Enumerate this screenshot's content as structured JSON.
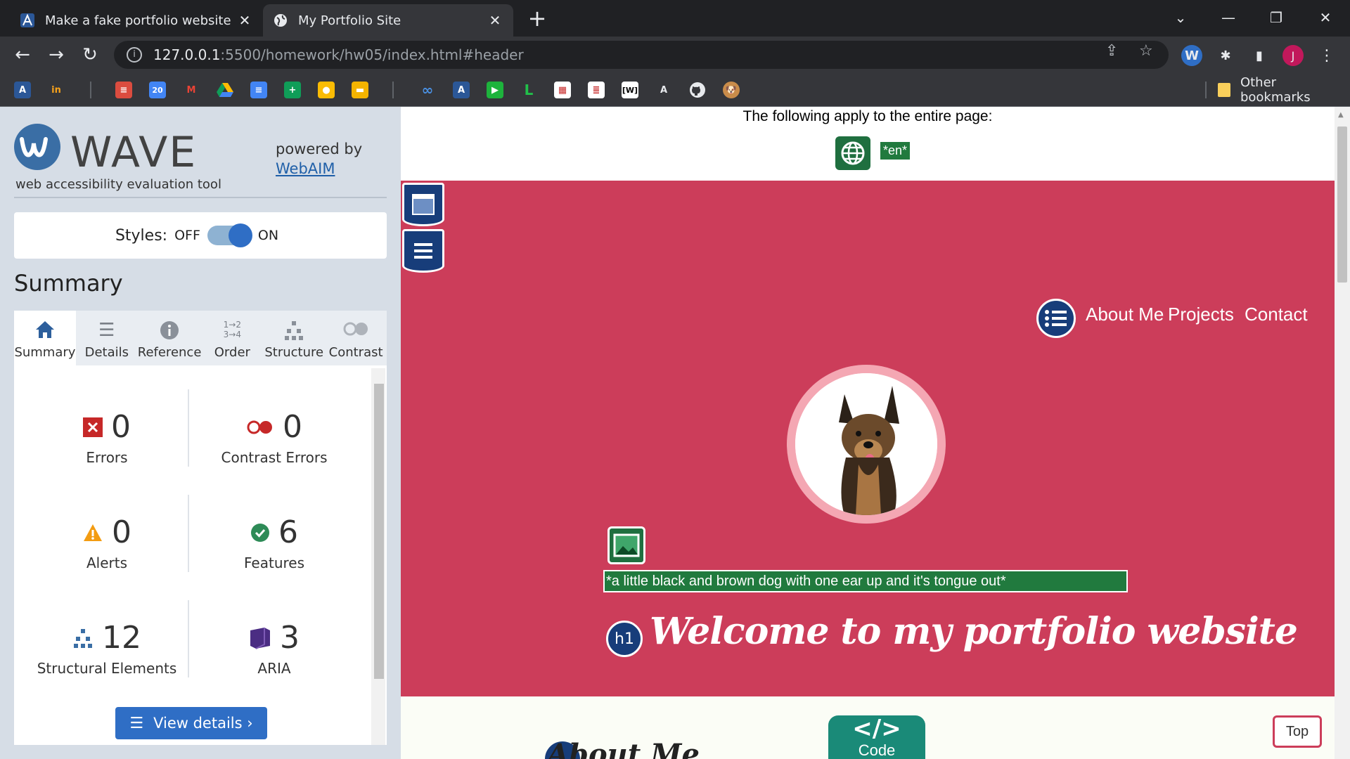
{
  "browser": {
    "tabs": [
      {
        "title": "Make a fake portfolio website",
        "icon": "app-a-icon"
      },
      {
        "title": "My Portfolio Site",
        "icon": "globe-icon"
      }
    ],
    "url_host": "127.0.0.1",
    "url_path": ":5500/homework/hw05/index.html#header",
    "profile_initial": "J",
    "other_bookmarks": "Other bookmarks",
    "bookmark_20": "20",
    "bookmark_w": "[W]",
    "bookmark_a": "A"
  },
  "wave": {
    "brand": "WAVE",
    "subtitle": "web accessibility evaluation tool",
    "powered_by": "powered by",
    "webaim": "WebAIM",
    "styles_label": "Styles:",
    "styles_off": "OFF",
    "styles_on": "ON",
    "summary_heading": "Summary",
    "tabs": [
      {
        "label": "Summary",
        "icon": "home-icon"
      },
      {
        "label": "Details",
        "icon": "list-icon"
      },
      {
        "label": "Reference",
        "icon": "info-icon"
      },
      {
        "label": "Order",
        "icon": "order-icon"
      },
      {
        "label": "Structure",
        "icon": "structure-icon"
      },
      {
        "label": "Contrast",
        "icon": "contrast-icon"
      }
    ],
    "order_icon_text": "1→2 3→4",
    "stats": [
      {
        "label": "Errors",
        "value": "0"
      },
      {
        "label": "Contrast Errors",
        "value": "0"
      },
      {
        "label": "Alerts",
        "value": "0"
      },
      {
        "label": "Features",
        "value": "6"
      },
      {
        "label": "Structural Elements",
        "value": "12"
      },
      {
        "label": "ARIA",
        "value": "3"
      }
    ],
    "view_details": "View details ›"
  },
  "page": {
    "note": "The following apply to the entire page:",
    "lang_tag": "*en*",
    "nav_links": [
      "About Me",
      "Projects",
      "Contact"
    ],
    "alt_text": "*a little black and brown dog with one ear up and it's tongue out*",
    "h1_badge": "h1",
    "heading": "Welcome to my portfolio website",
    "code_symbol": "</>",
    "code_word": "Code",
    "about_peek": "About Me",
    "top_button": "Top"
  },
  "colors": {
    "hero": "#cc3d5a",
    "wave_blue": "#2f6ec5",
    "wave_green": "#217a3e"
  }
}
